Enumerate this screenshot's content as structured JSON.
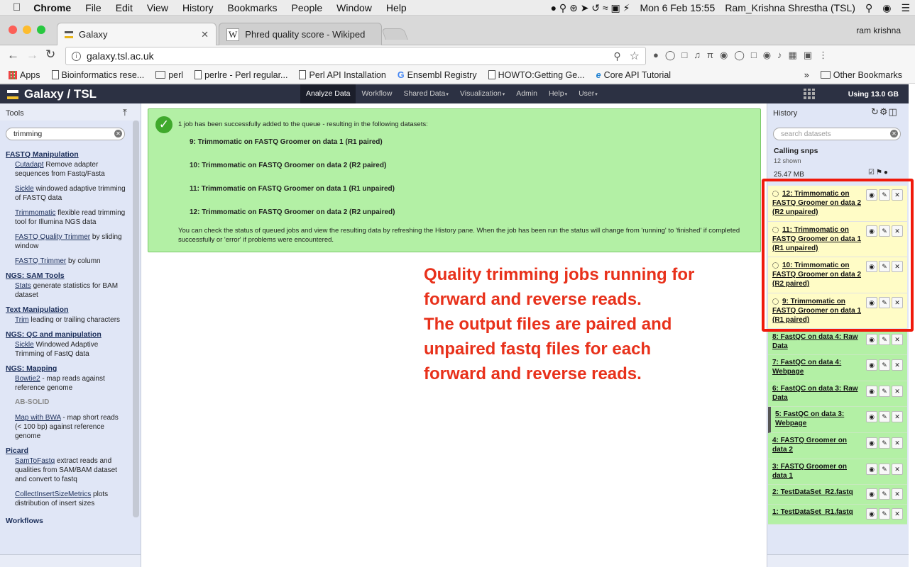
{
  "menubar": {
    "app": "Chrome",
    "items": [
      "File",
      "Edit",
      "View",
      "History",
      "Bookmarks",
      "People",
      "Window",
      "Help"
    ],
    "datetime": "Mon 6 Feb  15:55",
    "user": "Ram_Krishna Shrestha (TSL)"
  },
  "tabs": [
    {
      "title": "Galaxy",
      "active": true
    },
    {
      "title": "Phred quality score - Wikipedia",
      "active": false
    }
  ],
  "profile": "ram krishna",
  "omnibox": {
    "url": "galaxy.tsl.ac.uk"
  },
  "bookmarks": {
    "apps": "Apps",
    "items": [
      "Bioinformatics rese...",
      "perl",
      "perlre - Perl regular...",
      "Perl API Installation",
      "Ensembl Registry",
      "HOWTO:Getting Ge...",
      "Core API Tutorial"
    ],
    "overflow": "»",
    "other": "Other Bookmarks"
  },
  "galaxy": {
    "brand": "Galaxy / TSL",
    "nav": [
      "Analyze Data",
      "Workflow",
      "Shared Data",
      "Visualization",
      "Admin",
      "Help",
      "User"
    ],
    "quota": "Using 13.0 GB"
  },
  "tools_panel": {
    "title": "Tools",
    "search_value": "trimming",
    "sections": {
      "fastq_manip": "FASTQ Manipulation",
      "ngs_sam": "NGS: SAM Tools",
      "text_manip": "Text Manipulation",
      "ngs_qc": "NGS: QC and manipulation",
      "ngs_mapping": "NGS: Mapping",
      "picard": "Picard",
      "workflows": "Workflows"
    },
    "tools": {
      "cutadapt": {
        "name": "Cutadapt",
        "desc": " Remove adapter sequences from Fastq/Fasta"
      },
      "sickle": {
        "name": "Sickle",
        "desc": " windowed adaptive trimming of FASTQ data"
      },
      "trimmomatic": {
        "name": "Trimmomatic",
        "desc": " flexible read trimming tool for Illumina NGS data"
      },
      "fastq_quality_trimmer": {
        "name": "FASTQ Quality Trimmer",
        "desc": " by sliding window"
      },
      "fastq_trimmer": {
        "name": "FASTQ Trimmer",
        "desc": " by column"
      },
      "stats": {
        "name": "Stats",
        "desc": " generate statistics for BAM dataset"
      },
      "trim": {
        "name": "Trim",
        "desc": " leading or trailing characters"
      },
      "sickle2": {
        "name": "Sickle",
        "desc": " Windowed Adaptive Trimming of FastQ data"
      },
      "bowtie2": {
        "name": "Bowtie2",
        "desc": " - map reads against reference genome"
      },
      "bwa": {
        "name": "Map with BWA",
        "desc": " - map short reads (< 100 bp) against reference genome"
      },
      "samtofastq": {
        "name": "SamToFastq",
        "desc": " extract reads and qualities from SAM/BAM dataset and convert to fastq"
      },
      "collectinsert": {
        "name": "CollectInsertSizeMetrics",
        "desc": " plots distribution of insert sizes"
      }
    },
    "ab_solid": "AB-SOLID"
  },
  "message": {
    "heading": "1 job has been successfully added to the queue - resulting in the following datasets:",
    "datasets": [
      "9: Trimmomatic on FASTQ Groomer on data 1 (R1 paired)",
      "10: Trimmomatic on FASTQ Groomer on data 2 (R2 paired)",
      "11: Trimmomatic on FASTQ Groomer on data 1 (R1 unpaired)",
      "12: Trimmomatic on FASTQ Groomer on data 2 (R2 unpaired)"
    ],
    "footer": "You can check the status of queued jobs and view the resulting data by refreshing the History pane. When the job has been run the status will change from 'running' to 'finished' if completed successfully or 'error' if problems were encountered."
  },
  "annotation": {
    "lines": [
      "Quality trimming jobs running for",
      "forward and reverse reads.",
      "The output files are paired and",
      "unpaired fastq files for each",
      "forward and reverse reads."
    ]
  },
  "history": {
    "title": "History",
    "search_placeholder": "search datasets",
    "name": "Calling snps",
    "shown": "12 shown",
    "size": "25.47 MB",
    "items": [
      {
        "label": "12: Trimmomatic on FASTQ Groomer on data 2 (R2 unpaired)",
        "state": "queued"
      },
      {
        "label": "11: Trimmomatic on FASTQ Groomer on data 1 (R1 unpaired)",
        "state": "queued"
      },
      {
        "label": "10: Trimmomatic on FASTQ Groomer on data 2 (R2 paired)",
        "state": "queued"
      },
      {
        "label": "9: Trimmomatic on FASTQ Groomer on data 1 (R1 paired)",
        "state": "queued"
      },
      {
        "label": "8: FastQC on data 4: Raw Data",
        "state": "ok"
      },
      {
        "label": "7: FastQC on data 4: Webpage",
        "state": "ok"
      },
      {
        "label": "6: FastQC on data 3: Raw Data",
        "state": "ok"
      },
      {
        "label": "5: FastQC on data 3: Webpage",
        "state": "ok"
      },
      {
        "label": "4: FASTQ Groomer on data 2",
        "state": "ok"
      },
      {
        "label": "3: FASTQ Groomer on data 1",
        "state": "ok"
      },
      {
        "label": "2: TestDataSet_R2.fastq",
        "state": "ok"
      },
      {
        "label": "1: TestDataSet_R1.fastq",
        "state": "ok"
      }
    ]
  },
  "colors": {
    "masthead": "#2c3143",
    "ok": "#b3f0a5",
    "queued": "#fffcc6",
    "annotation": "#e8311b"
  }
}
